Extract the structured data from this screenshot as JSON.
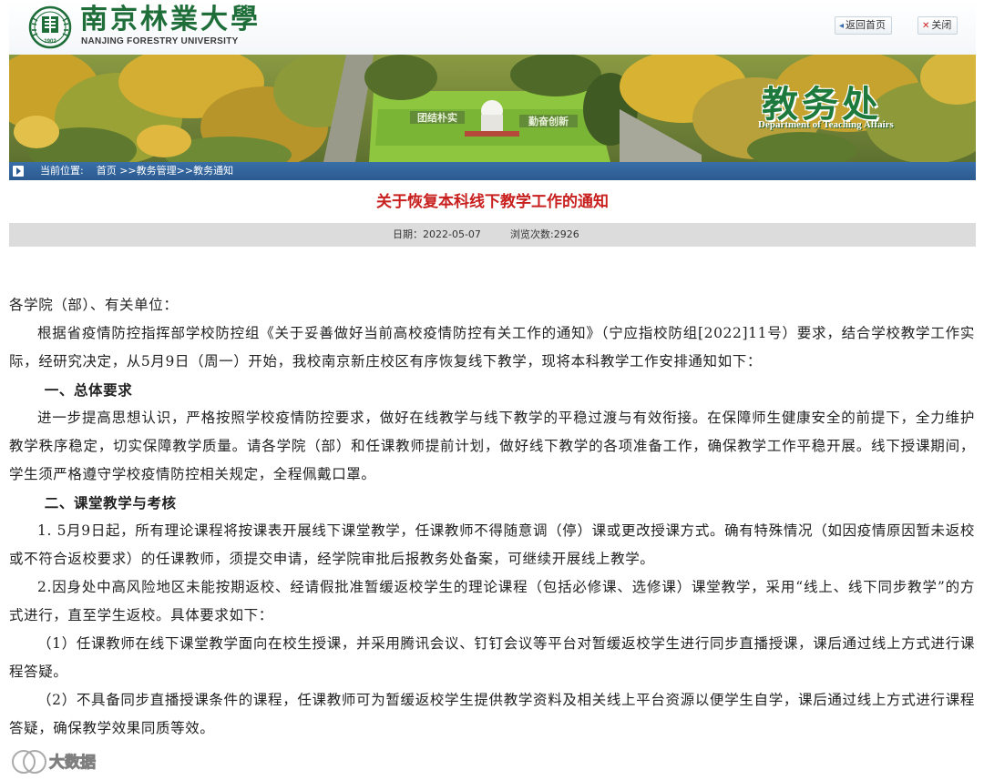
{
  "header": {
    "logo_cn": "南京林業大學",
    "logo_en": "NANJING FORESTRY UNIVERSITY",
    "logo_year": "1902",
    "home_button": "返回首页",
    "close_button": "关闭",
    "home_icon": "back-arrow-icon",
    "close_icon": "x-icon"
  },
  "banner": {
    "dept_cn": "教务处",
    "dept_en": "Department of Teaching Affairs",
    "sign_left": "团结朴实",
    "sign_right": "勤奋创新"
  },
  "breadcrumb": {
    "label": "当前位置:",
    "items": [
      "首页",
      ">>教务管理",
      ">>教务通知"
    ]
  },
  "article": {
    "title": "关于恢复本科线下教学工作的通知",
    "date_label": "日期：2022-05-07",
    "views_label": "浏览次数:2926",
    "paragraphs": [
      "各学院（部）、有关单位：",
      "根据省疫情防控指挥部学校防控组《关于妥善做好当前高校疫情防控有关工作的通知》（宁应指校防组[2022]11号）要求，结合学校教学工作实际，经研究决定，从5月9日（周一）开始，我校南京新庄校区有序恢复线下教学，现将本科教学工作安排通知如下：",
      "一、总体要求",
      "进一步提高思想认识，严格按照学校疫情防控要求，做好在线教学与线下教学的平稳过渡与有效衔接。在保障师生健康安全的前提下，全力维护教学秩序稳定，切实保障教学质量。请各学院（部）和任课教师提前计划，做好线下教学的各项准备工作，确保教学工作平稳开展。线下授课期间，学生须严格遵守学校疫情防控相关规定，全程佩戴口罩。",
      "二、课堂教学与考核",
      "1. 5月9日起，所有理论课程将按课表开展线下课堂教学，任课教师不得随意调（停）课或更改授课方式。确有特殊情况（如因疫情原因暂未返校或不符合返校要求）的任课教师，须提交申请，经学院审批后报教务处备案，可继续开展线上教学。",
      "2.因身处中高风险地区未能按期返校、经请假批准暂缓返校学生的理论课程（包括必修课、选修课）课堂教学，采用“线上、线下同步教学”的方式进行，直至学生返校。具体要求如下：",
      "（1）任课教师在线下课堂教学面向在校生授课，并采用腾讯会议、钉钉会议等平台对暂缓返校学生进行同步直播授课，课后通过线上方式进行课程答疑。",
      "（2）不具备同步直播授课条件的课程，任课教师可为暂缓返校学生提供教学资料及相关线上平台资源以便学生自学，课后通过线上方式进行课程答疑，确保教学效果同质等效。"
    ]
  },
  "watermark": "大数据"
}
